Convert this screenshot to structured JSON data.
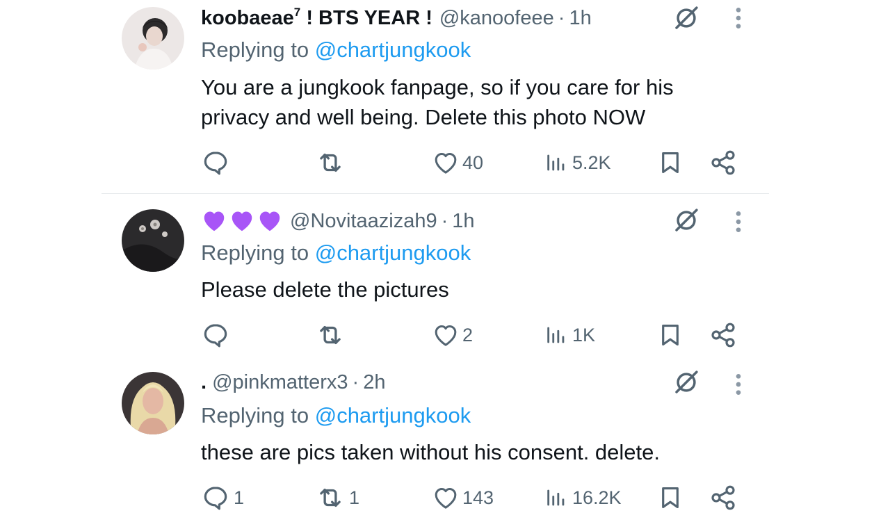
{
  "tweets": [
    {
      "name": "koobaeae",
      "name_sup": "7",
      "name_suffix": " ! BTS YEAR !",
      "handle": "@kanoofeee",
      "time": "1h",
      "replying_prefix": "Replying to ",
      "replying_to": "@chartjungkook",
      "text": "You are a jungkook fanpage, so if you care for his privacy and well being. Delete this photo NOW",
      "likes": "40",
      "views": "5.2K",
      "replies": "",
      "reposts": ""
    },
    {
      "name": "💜💜💜",
      "handle": "@Novitaazizah9",
      "time": "1h",
      "replying_prefix": "Replying to ",
      "replying_to": "@chartjungkook",
      "text": "Please delete the pictures",
      "likes": "2",
      "views": "1K",
      "replies": "",
      "reposts": ""
    },
    {
      "name": ".",
      "handle": "@pinkmatterx3",
      "time": "2h",
      "replying_prefix": "Replying to ",
      "replying_to": "@chartjungkook",
      "text": "these are pics taken without his consent. delete.",
      "likes": "143",
      "views": "16.2K",
      "replies": "1",
      "reposts": "1"
    }
  ],
  "separator": "·",
  "colors": {
    "accent": "#1d9bf0",
    "secondary": "#536471",
    "text": "#0f1419",
    "heart_purple": "#a855f7"
  },
  "icons": [
    "reply-icon",
    "repost-icon",
    "like-icon",
    "views-icon",
    "bookmark-icon",
    "share-icon",
    "grok-icon",
    "more-icon"
  ]
}
